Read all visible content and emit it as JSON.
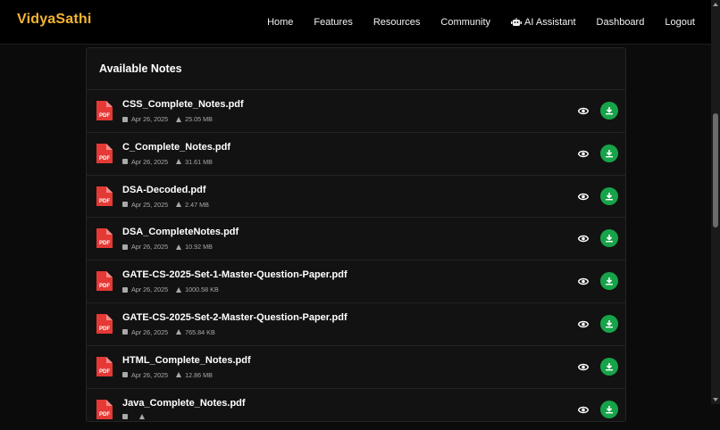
{
  "brand": {
    "part1": "Vidya",
    "part2": "Sathi"
  },
  "nav": {
    "home": "Home",
    "features": "Features",
    "resources": "Resources",
    "community": "Community",
    "ai_assistant": "AI Assistant",
    "dashboard": "Dashboard",
    "logout": "Logout"
  },
  "panel": {
    "title": "Available Notes"
  },
  "notes": [
    {
      "name": "CSS_Complete_Notes.pdf",
      "date": "Apr 26, 2025",
      "size": "25.05 MB"
    },
    {
      "name": "C_Complete_Notes.pdf",
      "date": "Apr 26, 2025",
      "size": "31.61 MB"
    },
    {
      "name": "DSA-Decoded.pdf",
      "date": "Apr 25, 2025",
      "size": "2.47 MB"
    },
    {
      "name": "DSA_CompleteNotes.pdf",
      "date": "Apr 26, 2025",
      "size": "10.92 MB"
    },
    {
      "name": "GATE-CS-2025-Set-1-Master-Question-Paper.pdf",
      "date": "Apr 26, 2025",
      "size": "1000.58 KB"
    },
    {
      "name": "GATE-CS-2025-Set-2-Master-Question-Paper.pdf",
      "date": "Apr 26, 2025",
      "size": "765.84 KB"
    },
    {
      "name": "HTML_Complete_Notes.pdf",
      "date": "Apr 26, 2025",
      "size": "12.86 MB"
    },
    {
      "name": "Java_Complete_Notes.pdf",
      "date": "",
      "size": ""
    }
  ],
  "icons": {
    "file": "pdf-file-icon",
    "view": "eye-icon",
    "download": "download-icon"
  },
  "colors": {
    "accent": "#f5b531",
    "pdf": "#e53935",
    "download": "#17a34a"
  }
}
